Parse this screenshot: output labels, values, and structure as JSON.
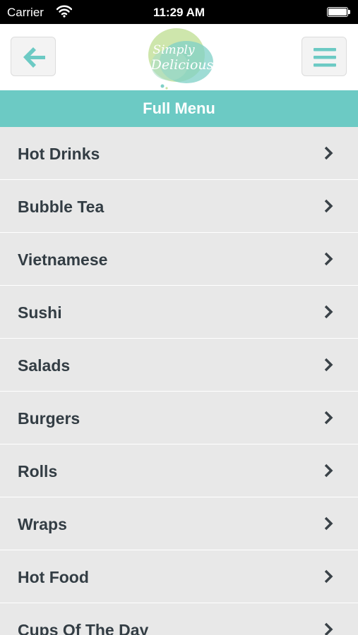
{
  "status_bar": {
    "carrier": "Carrier",
    "time": "11:29 AM",
    "icons": [
      "wifi-icon",
      "battery-icon"
    ]
  },
  "nav_bar": {
    "back_icon": "back-arrow-icon",
    "menu_icon": "hamburger-menu-icon",
    "logo_text_line1": "Simply",
    "logo_text_line2": "Delicious",
    "accent_color": "#6ccac4"
  },
  "header": {
    "title": "Full Menu"
  },
  "menu": {
    "items": [
      {
        "label": "Hot Drinks"
      },
      {
        "label": "Bubble Tea"
      },
      {
        "label": "Vietnamese"
      },
      {
        "label": "Sushi"
      },
      {
        "label": "Salads"
      },
      {
        "label": "Burgers"
      },
      {
        "label": "Rolls"
      },
      {
        "label": "Wraps"
      },
      {
        "label": "Hot Food"
      },
      {
        "label": "Cups Of The Day"
      }
    ],
    "item_icon": "chevron-right-icon",
    "item_background": "#e8e8e8",
    "text_color": "#333d44"
  }
}
